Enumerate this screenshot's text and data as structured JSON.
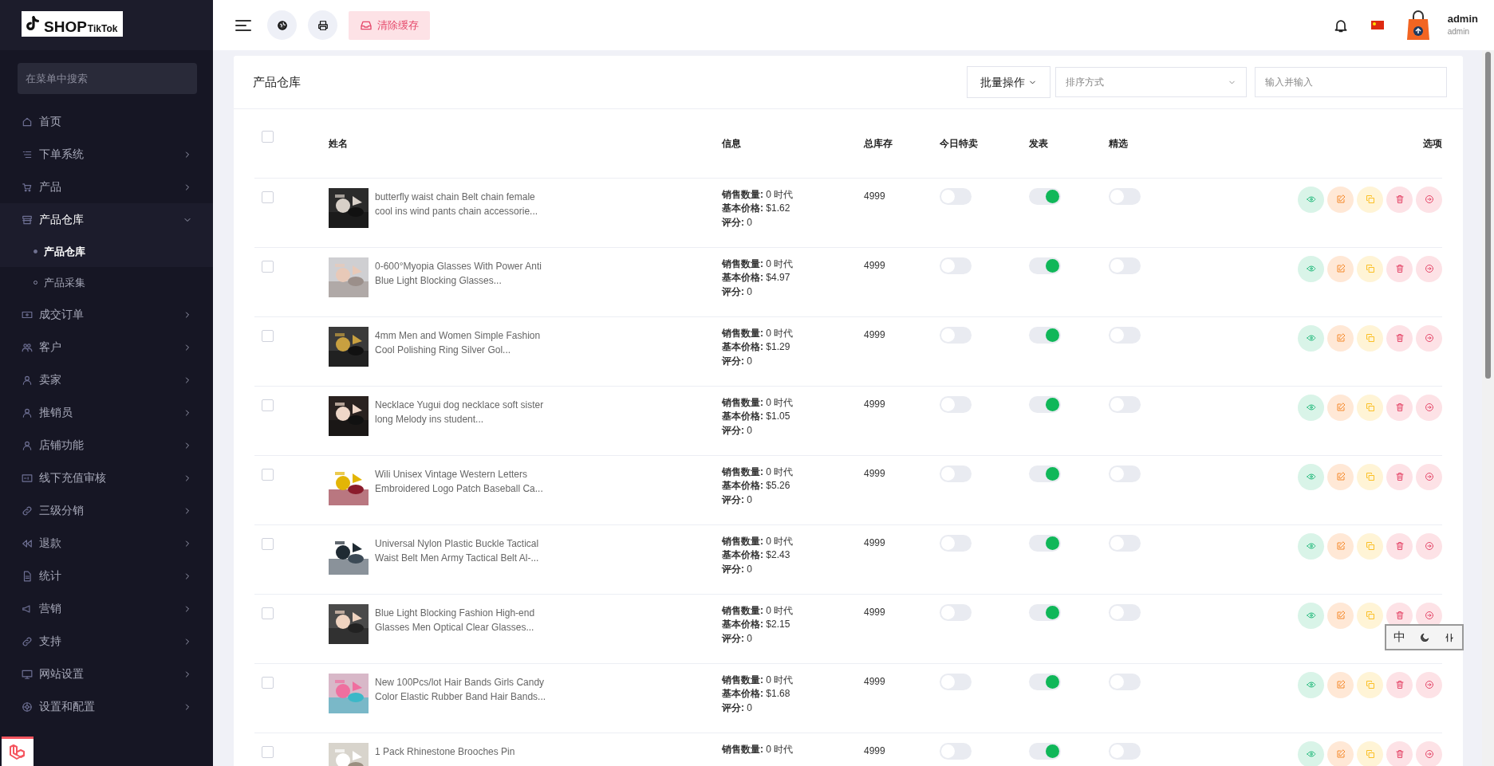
{
  "logo": {
    "brand": "SHOP",
    "sub": "TikTok"
  },
  "sidebar": {
    "search": {
      "placeholder": "在菜单中搜索"
    },
    "items": [
      {
        "label": "首页",
        "expandable": false,
        "expanded": false,
        "selected": false
      },
      {
        "label": "下单系统",
        "expandable": true,
        "expanded": false,
        "selected": false
      },
      {
        "label": "产品",
        "expandable": true,
        "expanded": false,
        "selected": false
      },
      {
        "label": "产品仓库",
        "expandable": true,
        "expanded": true,
        "selected": true,
        "children": [
          {
            "label": "产品仓库",
            "selected": true
          },
          {
            "label": "产品采集",
            "selected": false
          }
        ]
      },
      {
        "label": "成交订单",
        "expandable": true,
        "expanded": false,
        "selected": false
      },
      {
        "label": "客户",
        "expandable": true,
        "expanded": false,
        "selected": false
      },
      {
        "label": "卖家",
        "expandable": true,
        "expanded": false,
        "selected": false
      },
      {
        "label": "推销员",
        "expandable": true,
        "expanded": false,
        "selected": false
      },
      {
        "label": "店铺功能",
        "expandable": true,
        "expanded": false,
        "selected": false
      },
      {
        "label": "线下充值审核",
        "expandable": true,
        "expanded": false,
        "selected": false
      },
      {
        "label": "三级分销",
        "expandable": true,
        "expanded": false,
        "selected": false
      },
      {
        "label": "退款",
        "expandable": true,
        "expanded": false,
        "selected": false
      },
      {
        "label": "统计",
        "expandable": true,
        "expanded": false,
        "selected": false
      },
      {
        "label": "营销",
        "expandable": true,
        "expanded": false,
        "selected": false
      },
      {
        "label": "支持",
        "expandable": true,
        "expanded": false,
        "selected": false
      },
      {
        "label": "网站设置",
        "expandable": true,
        "expanded": false,
        "selected": false
      },
      {
        "label": "设置和配置",
        "expandable": true,
        "expanded": false,
        "selected": false
      }
    ]
  },
  "topbar": {
    "clear_cache": "清除缓存",
    "user": {
      "name": "admin",
      "role": "admin"
    }
  },
  "card": {
    "title": "产品仓库",
    "bulk_action": "批量操作",
    "sort": {
      "placeholder": "排序方式"
    },
    "search": {
      "placeholder": "输入并输入"
    }
  },
  "table": {
    "select_all": {
      "checked": false
    },
    "columns": [
      "姓名",
      "信息",
      "总库存",
      "今日特卖",
      "发表",
      "精选",
      "选项"
    ],
    "rows": [
      {
        "checked": false,
        "name": "butterfly waist chain Belt chain female cool ins wind pants chain accessorie...",
        "info": [
          "**销售数量:** 0 时代",
          "**基本价格:** $1.62",
          "**评分:** 0"
        ],
        "stock": "4999",
        "today_sale": false,
        "published": true,
        "featured": false
      },
      {
        "checked": false,
        "name": "0-600°Myopia Glasses With Power Anti Blue Light Blocking Glasses...",
        "info": [
          "**销售数量:** 0 时代",
          "**基本价格:** $4.97",
          "**评分:** 0"
        ],
        "stock": "4999",
        "today_sale": false,
        "published": true,
        "featured": false
      },
      {
        "checked": false,
        "name": "4mm Men and Women Simple Fashion Cool Polishing Ring Silver Gol...",
        "info": [
          "**销售数量:** 0 时代",
          "**基本价格:** $1.29",
          "**评分:** 0"
        ],
        "stock": "4999",
        "today_sale": false,
        "published": true,
        "featured": false
      },
      {
        "checked": false,
        "name": "Necklace Yugui dog necklace soft sister long Melody ins student...",
        "info": [
          "**销售数量:** 0 时代",
          "**基本价格:** $1.05",
          "**评分:** 0"
        ],
        "stock": "4999",
        "today_sale": false,
        "published": true,
        "featured": false
      },
      {
        "checked": false,
        "name": "Wili Unisex Vintage Western Letters Embroidered Logo Patch Baseball Ca...",
        "info": [
          "**销售数量:** 0 时代",
          "**基本价格:** $5.26",
          "**评分:** 0"
        ],
        "stock": "4999",
        "today_sale": false,
        "published": true,
        "featured": false
      },
      {
        "checked": false,
        "name": "Universal Nylon Plastic Buckle Tactical Waist Belt Men Army Tactical Belt Al-...",
        "info": [
          "**销售数量:** 0 时代",
          "**基本价格:** $2.43",
          "**评分:** 0"
        ],
        "stock": "4999",
        "today_sale": false,
        "published": true,
        "featured": false
      },
      {
        "checked": false,
        "name": "Blue Light Blocking Fashion High-end Glasses Men Optical Clear Glasses...",
        "info": [
          "**销售数量:** 0 时代",
          "**基本价格:** $2.15",
          "**评分:** 0"
        ],
        "stock": "4999",
        "today_sale": false,
        "published": true,
        "featured": false
      },
      {
        "checked": false,
        "name": "New 100Pcs/lot Hair Bands Girls Candy Color Elastic Rubber Band Hair Bands...",
        "info": [
          "**销售数量:** 0 时代",
          "**基本价格:** $1.68",
          "**评分:** 0"
        ],
        "stock": "4999",
        "today_sale": false,
        "published": true,
        "featured": false
      },
      {
        "checked": false,
        "name": "1 Pack Rhinestone Brooches Pin",
        "info": [
          "**销售数量:** 0 时代"
        ],
        "stock": "4999",
        "today_sale": false,
        "published": true,
        "featured": false
      }
    ]
  },
  "ime_toolbar": {
    "mode": "中"
  }
}
